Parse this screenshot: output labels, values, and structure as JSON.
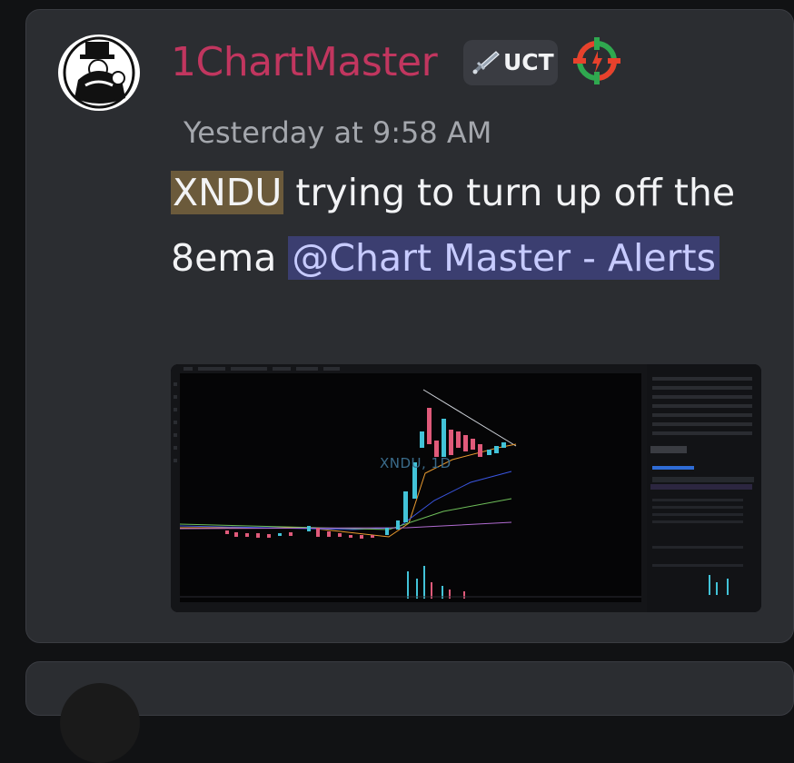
{
  "message": {
    "username": "1ChartMaster",
    "tag": {
      "icon": "sword-icon",
      "label": "UCT"
    },
    "role_icon": "target-logo-icon",
    "timestamp": "Yesterday at 9:58 AM",
    "ticker": "XNDU",
    "text_after_ticker": " trying to turn up off the 8ema ",
    "mention": "@Chart Master - Alerts",
    "attachment": {
      "kind": "trading-chart-screenshot",
      "chart_symbol": "XNDU, 1D"
    }
  },
  "colors": {
    "username": "#c1365f",
    "ticker_highlight": "#6b5a3b",
    "mention_bg": "#3b3e70",
    "mention_text": "#c7cbff",
    "card_bg": "#2b2d31"
  }
}
